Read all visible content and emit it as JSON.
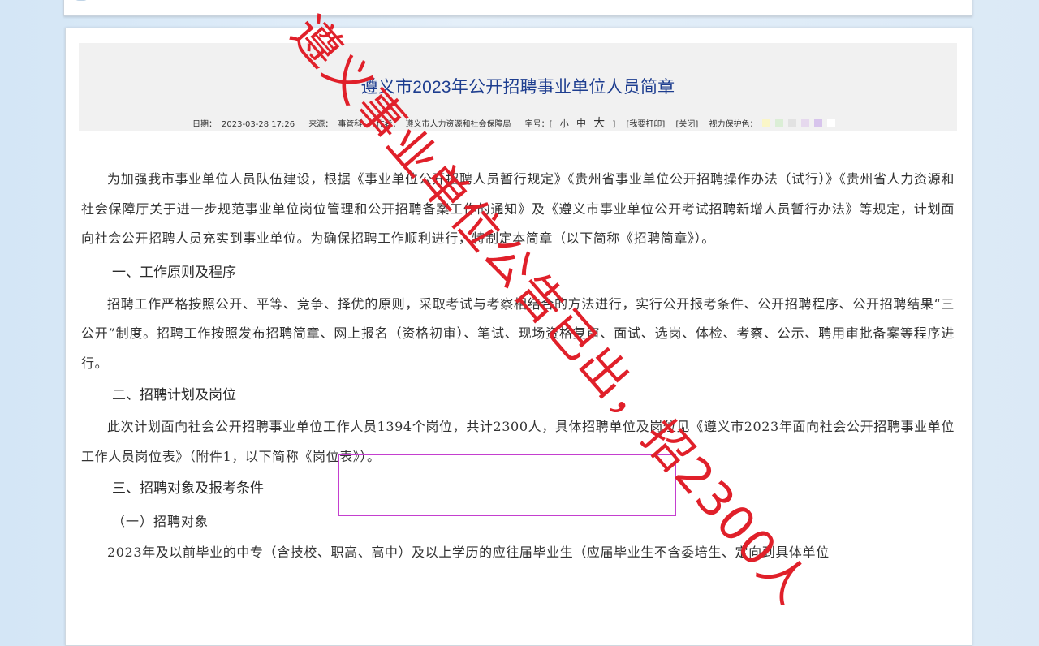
{
  "article": {
    "title": "遵义市2023年公开招聘事业单位人员简章",
    "meta": {
      "date_label": "日期：",
      "date": "2023-03-28 17:26",
      "source_label": "来源：",
      "source": "事管科",
      "author_label": "作者：",
      "author": "遵义市人力资源和社会保障局",
      "font_size_label": "字号：[",
      "size_small": "小",
      "size_medium": "中",
      "size_large": "大",
      "font_size_end": "]",
      "print": "[我要打印]",
      "close": "[关闭]",
      "vision_label": "视力保护色：",
      "vision_colors": [
        "#faf6c8",
        "#dbeed6",
        "#e2e2e2",
        "#e6d9ee",
        "#d7c4ec",
        "#ffffff"
      ]
    },
    "paragraphs": [
      "为加强我市事业单位人员队伍建设，根据《事业单位公开招聘人员暂行规定》《贵州省事业单位公开招聘操作办法（试行）》《贵州省人力资源和社会保障厅关于进一步规范事业单位岗位管理和公开招聘备案工作的通知》及《遵义市事业单位公开考试招聘新增人员暂行办法》等规定，计划面向社会公开招聘人员充实到事业单位。为确保招聘工作顺利进行，特制定本简章（以下简称《招聘简章》）。"
    ],
    "section1_heading": "一、工作原则及程序",
    "section1_para": "招聘工作严格按照公开、平等、竞争、择优的原则，采取考试与考察相结合的方法进行，实行公开报考条件、公开招聘程序、公开招聘结果“三公开”制度。招聘工作按照发布招聘简章、网上报名（资格初审）、笔试、现场资格复审、面试、选岗、体检、考察、公示、聘用审批备案等程序进行。",
    "section2_heading": "二、招聘计划及岗位",
    "section2_para": "此次计划面向社会公开招聘事业单位工作人员1394个岗位，共计2300人，具体招聘单位及岗位见《遵义市2023年面向社会公开招聘事业单位工作人员岗位表》（附件1，以下简称《岗位表》）。",
    "section3_heading": "三、招聘对象及报考条件",
    "section3_sub": "（一）招聘对象",
    "section3_para": "2023年及以前毕业的中专（含技校、职高、高中）及以上学历的应往届毕业生（应届毕业生不含委培生、定向到具体单位"
  },
  "annotation": {
    "handwritten_text": "遵义事业单位公告已出，招2300人",
    "ink_color": "#e0202a",
    "box_color": "#c43fcf"
  }
}
